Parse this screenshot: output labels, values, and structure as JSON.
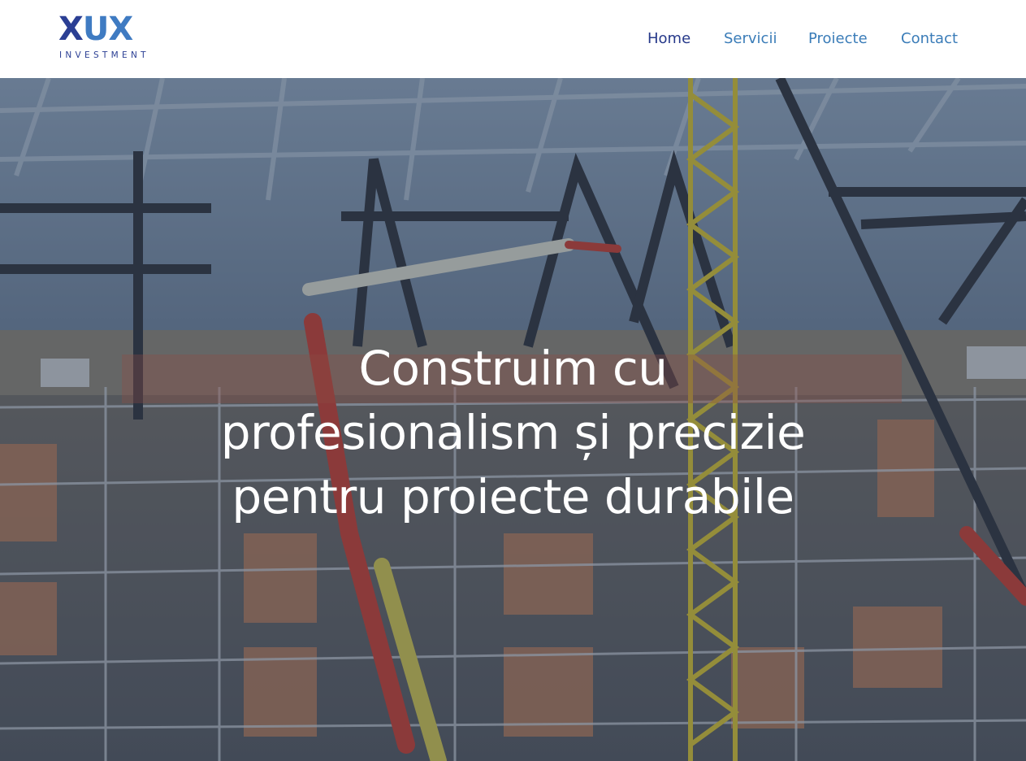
{
  "header": {
    "logo": {
      "mark": "XUX",
      "mark_first": "X",
      "mark_rest": "UX",
      "subtitle": "INVESTMENT"
    },
    "nav": [
      {
        "label": "Home",
        "active": true
      },
      {
        "label": "Servicii",
        "active": false
      },
      {
        "label": "Proiecte",
        "active": false
      },
      {
        "label": "Contact",
        "active": false
      }
    ]
  },
  "hero": {
    "headline_lines": [
      "Construim cu",
      "profesionalism și precizie",
      "pentru proiecte durabile"
    ],
    "background_image": "construction-site-photo"
  },
  "colors": {
    "brand_dark": "#2b3f94",
    "brand_light": "#3f7bc2",
    "nav_active": "#26398a",
    "nav": "#3a7cb8"
  }
}
